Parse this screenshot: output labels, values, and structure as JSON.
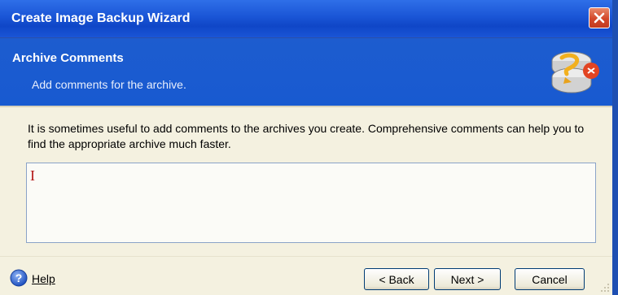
{
  "window": {
    "title": "Create Image Backup Wizard",
    "close_icon": "close-icon",
    "accent_color": "#1a55d6"
  },
  "header": {
    "title": "Archive Comments",
    "subtitle": "Add comments for the archive.",
    "icon": "disk-backup-icon"
  },
  "main": {
    "description": "It is sometimes useful to add comments to the archives you create. Comprehensive comments can help you to find the appropriate archive much faster.",
    "comments_value": ""
  },
  "footer": {
    "help_label": "Help",
    "help_icon": "help-icon",
    "back_label": "< Back",
    "next_label": "Next >",
    "cancel_label": "Cancel"
  }
}
